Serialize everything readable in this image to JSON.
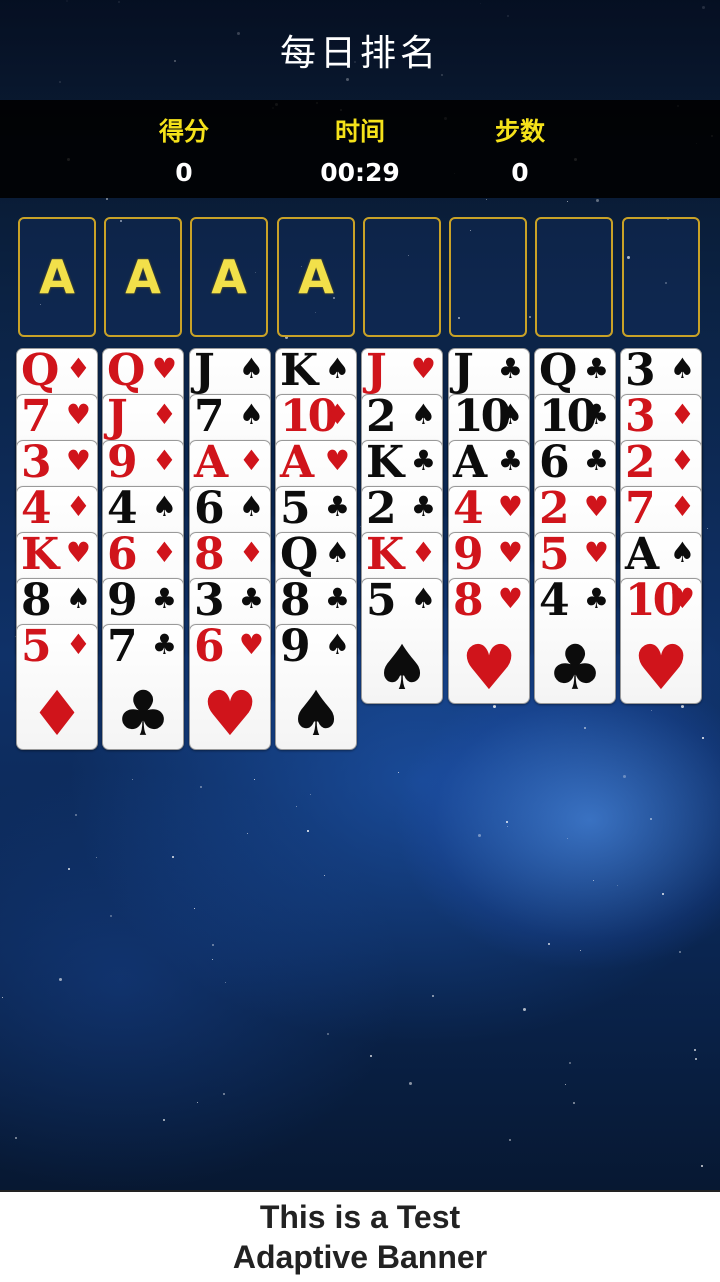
{
  "header": {
    "title": "每日排名"
  },
  "stats": {
    "score_label": "得分",
    "score_value": "0",
    "time_label": "时间",
    "time_value": "00:29",
    "moves_label": "步数",
    "moves_value": "0"
  },
  "colors": {
    "red": "#d0141b",
    "black": "#0c0c0c",
    "accent": "#f5e21a",
    "slot_border": "#c9a227"
  },
  "slots": [
    {
      "label": "A"
    },
    {
      "label": "A"
    },
    {
      "label": "A"
    },
    {
      "label": "A"
    },
    {
      "label": ""
    },
    {
      "label": ""
    },
    {
      "label": ""
    },
    {
      "label": ""
    }
  ],
  "tableau": [
    [
      {
        "rank": "Q",
        "suit": "diamonds"
      },
      {
        "rank": "7",
        "suit": "hearts"
      },
      {
        "rank": "3",
        "suit": "hearts"
      },
      {
        "rank": "4",
        "suit": "diamonds"
      },
      {
        "rank": "K",
        "suit": "hearts"
      },
      {
        "rank": "8",
        "suit": "spades"
      },
      {
        "rank": "5",
        "suit": "diamonds"
      }
    ],
    [
      {
        "rank": "Q",
        "suit": "hearts"
      },
      {
        "rank": "J",
        "suit": "diamonds"
      },
      {
        "rank": "9",
        "suit": "diamonds"
      },
      {
        "rank": "4",
        "suit": "spades"
      },
      {
        "rank": "6",
        "suit": "diamonds"
      },
      {
        "rank": "9",
        "suit": "clubs"
      },
      {
        "rank": "7",
        "suit": "clubs"
      }
    ],
    [
      {
        "rank": "J",
        "suit": "spades"
      },
      {
        "rank": "7",
        "suit": "spades"
      },
      {
        "rank": "A",
        "suit": "diamonds"
      },
      {
        "rank": "6",
        "suit": "spades"
      },
      {
        "rank": "8",
        "suit": "diamonds"
      },
      {
        "rank": "3",
        "suit": "clubs"
      },
      {
        "rank": "6",
        "suit": "hearts"
      }
    ],
    [
      {
        "rank": "K",
        "suit": "spades"
      },
      {
        "rank": "10",
        "suit": "diamonds"
      },
      {
        "rank": "A",
        "suit": "hearts"
      },
      {
        "rank": "5",
        "suit": "clubs"
      },
      {
        "rank": "Q",
        "suit": "spades"
      },
      {
        "rank": "8",
        "suit": "clubs"
      },
      {
        "rank": "9",
        "suit": "spades"
      }
    ],
    [
      {
        "rank": "J",
        "suit": "hearts"
      },
      {
        "rank": "2",
        "suit": "spades"
      },
      {
        "rank": "K",
        "suit": "clubs"
      },
      {
        "rank": "2",
        "suit": "clubs"
      },
      {
        "rank": "K",
        "suit": "diamonds"
      },
      {
        "rank": "5",
        "suit": "spades"
      }
    ],
    [
      {
        "rank": "J",
        "suit": "clubs"
      },
      {
        "rank": "10",
        "suit": "spades"
      },
      {
        "rank": "A",
        "suit": "clubs"
      },
      {
        "rank": "4",
        "suit": "hearts"
      },
      {
        "rank": "9",
        "suit": "hearts"
      },
      {
        "rank": "8",
        "suit": "hearts"
      }
    ],
    [
      {
        "rank": "Q",
        "suit": "clubs"
      },
      {
        "rank": "10",
        "suit": "clubs"
      },
      {
        "rank": "6",
        "suit": "clubs"
      },
      {
        "rank": "2",
        "suit": "hearts"
      },
      {
        "rank": "5",
        "suit": "hearts"
      },
      {
        "rank": "4",
        "suit": "clubs"
      }
    ],
    [
      {
        "rank": "3",
        "suit": "spades"
      },
      {
        "rank": "3",
        "suit": "diamonds"
      },
      {
        "rank": "2",
        "suit": "diamonds"
      },
      {
        "rank": "7",
        "suit": "diamonds"
      },
      {
        "rank": "A",
        "suit": "spades"
      },
      {
        "rank": "10",
        "suit": "hearts"
      }
    ]
  ],
  "banner": {
    "line1": "This is a Test",
    "line2": "Adaptive Banner"
  }
}
